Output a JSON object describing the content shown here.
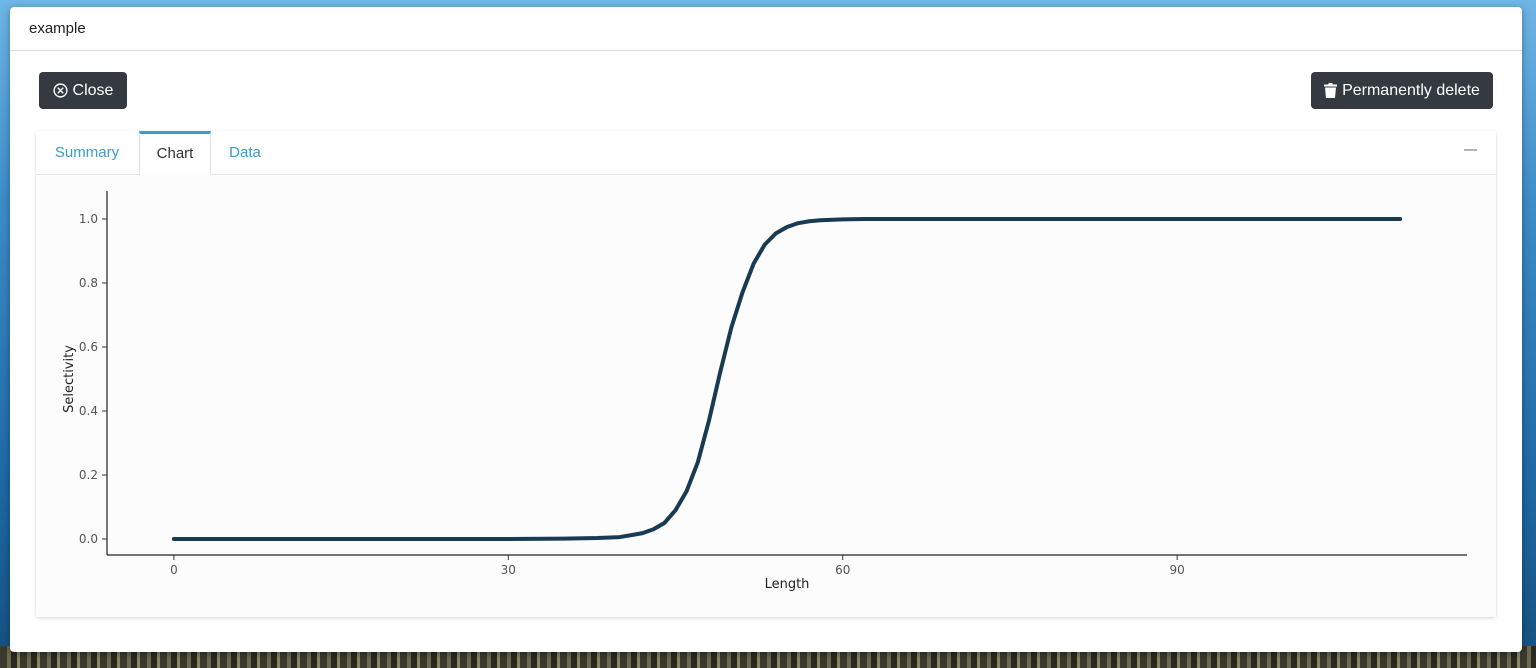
{
  "modal": {
    "title": "example"
  },
  "actions": {
    "close_label": "Close",
    "delete_label": "Permanently delete"
  },
  "tabs": [
    {
      "label": "Summary",
      "active": false
    },
    {
      "label": "Chart",
      "active": true
    },
    {
      "label": "Data",
      "active": false
    }
  ],
  "icons": {
    "close": "circle-x-icon",
    "delete": "trash-icon",
    "collapse": "minus-icon"
  },
  "colors": {
    "button_bg": "#343a40",
    "tab_link": "#3c9bc9",
    "line": "#183a52"
  },
  "chart_data": {
    "type": "line",
    "xlabel": "Length",
    "ylabel": "Selectivity",
    "xlim": [
      -6,
      116
    ],
    "ylim": [
      -0.05,
      1.05
    ],
    "xticks": [
      0,
      30,
      60,
      90
    ],
    "yticks": [
      0.0,
      0.2,
      0.4,
      0.6,
      0.8,
      1.0
    ],
    "grid": false,
    "series": [
      {
        "x": [
          0,
          10,
          20,
          30,
          35,
          38,
          40,
          42,
          43,
          44,
          45,
          46,
          47,
          48,
          49,
          50,
          51,
          52,
          53,
          54,
          55,
          56,
          57,
          58,
          60,
          62,
          65,
          70,
          80,
          90,
          100,
          110
        ],
        "y": [
          0.0,
          0.0,
          0.0,
          0.0,
          0.001,
          0.003,
          0.006,
          0.018,
          0.03,
          0.05,
          0.09,
          0.15,
          0.24,
          0.37,
          0.52,
          0.66,
          0.77,
          0.86,
          0.92,
          0.955,
          0.975,
          0.987,
          0.993,
          0.996,
          0.999,
          1.0,
          1.0,
          1.0,
          1.0,
          1.0,
          1.0,
          1.0
        ]
      }
    ]
  }
}
